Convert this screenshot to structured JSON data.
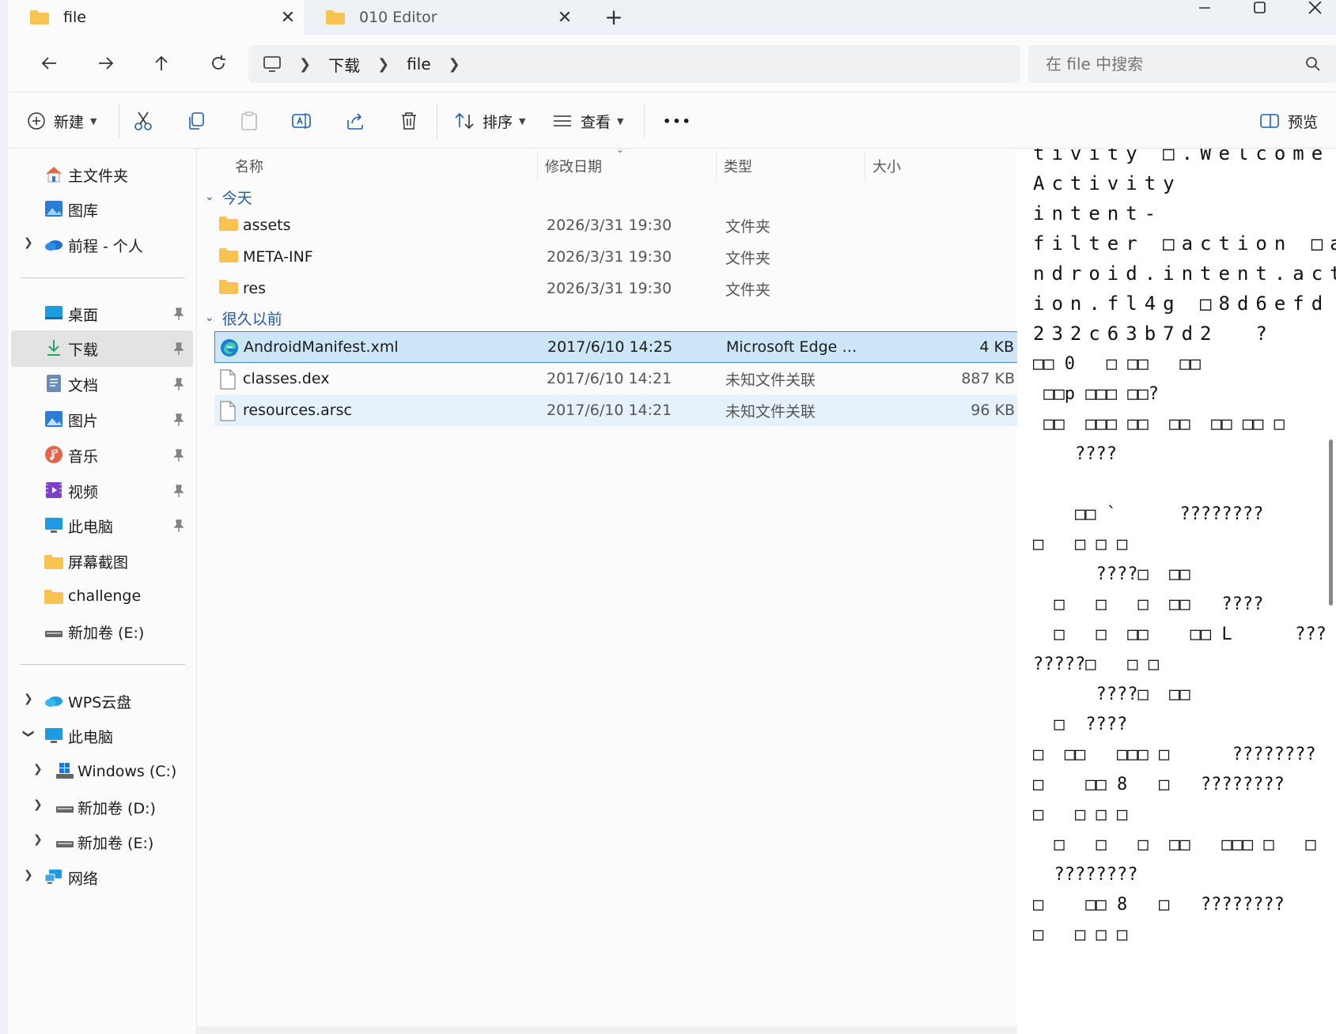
{
  "tabs": [
    {
      "title": "file",
      "active": true
    },
    {
      "title": "010 Editor",
      "active": false
    }
  ],
  "window": {
    "new_tab_glyph": "+"
  },
  "address": {
    "crumbs": [
      "下载",
      "file"
    ],
    "search_placeholder": "在 file 中搜索"
  },
  "commands": {
    "new_label": "新建",
    "sort_label": "排序",
    "view_label": "查看",
    "more_label": "•••",
    "preview_label": "预览"
  },
  "sidebar": {
    "items": [
      {
        "label": "主文件夹",
        "icon": "home-icon"
      },
      {
        "label": "图库",
        "icon": "gallery-icon"
      },
      {
        "label": "前程 - 个人",
        "icon": "onedrive-icon"
      },
      {
        "label": "桌面",
        "icon": "desktop-icon"
      },
      {
        "label": "下载",
        "icon": "download-icon"
      },
      {
        "label": "文档",
        "icon": "documents-icon"
      },
      {
        "label": "图片",
        "icon": "pictures-icon"
      },
      {
        "label": "音乐",
        "icon": "music-icon"
      },
      {
        "label": "视频",
        "icon": "videos-icon"
      },
      {
        "label": "此电脑",
        "icon": "pc-icon"
      },
      {
        "label": "屏幕截图",
        "icon": "folder-icon"
      },
      {
        "label": "challenge",
        "icon": "folder-icon"
      },
      {
        "label": "新加卷 (E:)",
        "icon": "drive-icon"
      },
      {
        "label": "WPS云盘",
        "icon": "cloud-icon"
      },
      {
        "label": "此电脑",
        "icon": "pc-icon"
      },
      {
        "label": "Windows (C:)",
        "icon": "windows-drive-icon"
      },
      {
        "label": "新加卷 (D:)",
        "icon": "drive-icon"
      },
      {
        "label": "新加卷 (E:)",
        "icon": "drive-icon"
      },
      {
        "label": "网络",
        "icon": "network-icon"
      }
    ]
  },
  "filelist": {
    "columns": [
      "名称",
      "修改日期",
      "类型",
      "大小"
    ],
    "groups": [
      {
        "label": "今天",
        "rows": [
          {
            "name": "assets",
            "date": "2026/3/31 19:30",
            "type": "文件夹",
            "size": ""
          },
          {
            "name": "META-INF",
            "date": "2026/3/31 19:30",
            "type": "文件夹",
            "size": ""
          },
          {
            "name": "res",
            "date": "2026/3/31 19:30",
            "type": "文件夹",
            "size": ""
          }
        ]
      },
      {
        "label": "很久以前",
        "rows": [
          {
            "name": "AndroidManifest.xml",
            "date": "2017/6/10 14:25",
            "type": "Microsoft Edge HT...",
            "size": "4 KB"
          },
          {
            "name": "classes.dex",
            "date": "2017/6/10 14:21",
            "type": "未知文件关联",
            "size": "887 KB"
          },
          {
            "name": "resources.arsc",
            "date": "2017/6/10 14:21",
            "type": "未知文件关联",
            "size": "96 KB"
          }
        ]
      }
    ]
  },
  "preview": {
    "lines": [
      "tivity □.Welcome",
      "Activity",
      "intent-",
      "filter □action □a",
      "ndroid.intent.act",
      "ion.fl4g □8d6efd",
      "232c63b7d2  ?",
      "□□ 0   □ □□   □□",
      " □□p □□□ □□?",
      " □□  □□□ □□  □□  □□ □□ □",
      "    ????",
      "",
      "    □□ `      ????????",
      "□   □ □ □",
      "      ????□  □□",
      "  □   □   □  □□   ????",
      "  □   □  □□    □□ L      ???",
      "?????□   □ □",
      "      ????□  □□",
      "  □  ????",
      "□  □□   □□□ □      ????????",
      "□    □□ 8   □   ????????",
      "□   □ □ □",
      "  □   □   □  □□   □□□ □   □",
      "  ????????",
      "□    □□ 8   □   ????????",
      "□   □ □ □"
    ]
  },
  "colors": {
    "selection": "#cde6f7",
    "selection_border": "#3b87c9",
    "group_text": "#2457a8",
    "folder": "#f8c44f"
  }
}
